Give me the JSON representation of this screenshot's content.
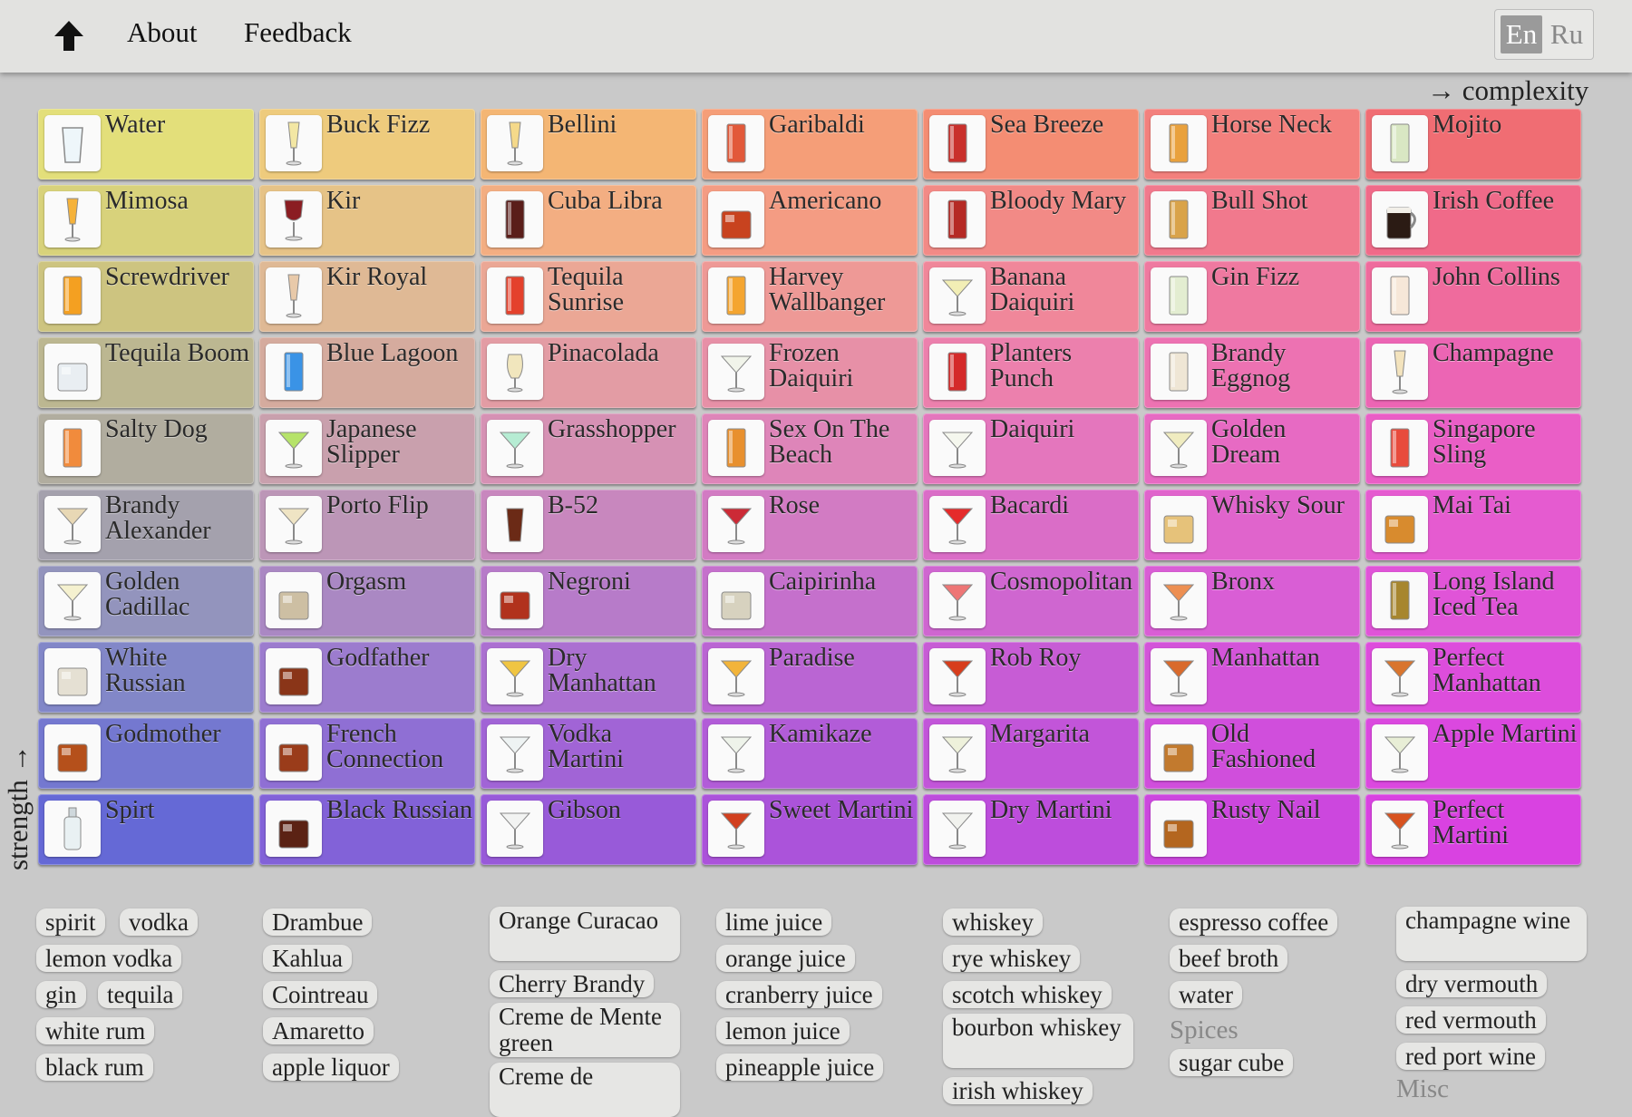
{
  "nav": {
    "about": "About",
    "feedback": "Feedback",
    "lang_en": "En",
    "lang_ru": "Ru"
  },
  "axes": {
    "complexity": "→ complexity",
    "strength": "strength →"
  },
  "cocktails": [
    [
      "Water",
      "Buck Fizz",
      "Bellini",
      "Garibaldi",
      "Sea Breeze",
      "Horse Neck",
      "Mojito"
    ],
    [
      "Mimosa",
      "Kir",
      "Cuba Libra",
      "Americano",
      "Bloody Mary",
      "Bull Shot",
      "Irish Coffee"
    ],
    [
      "Screwdriver",
      "Kir Royal",
      "Tequila Sunrise",
      "Harvey Wallbanger",
      "Banana Daiquiri",
      "Gin Fizz",
      "John Collins"
    ],
    [
      "Tequila Boom",
      "Blue Lagoon",
      "Pinacolada",
      "Frozen Daiquiri",
      "Planters Punch",
      "Brandy Eggnog",
      "Champagne"
    ],
    [
      "Salty Dog",
      "Japanese Slipper",
      "Grasshopper",
      "Sex On The Beach",
      "Daiquiri",
      "Golden Dream",
      "Singapore Sling"
    ],
    [
      "Brandy Alexander",
      "Porto Flip",
      "B-52",
      "Rose",
      "Bacardi",
      "Whisky Sour",
      "Mai Tai"
    ],
    [
      "Golden Cadillac",
      "Orgasm",
      "Negroni",
      "Caipirinha",
      "Cosmopolitan",
      "Bronx",
      "Long Island Iced Tea"
    ],
    [
      "White Russian",
      "Godfather",
      "Dry Manhattan",
      "Paradise",
      "Rob Roy",
      "Manhattan",
      "Perfect Manhattan"
    ],
    [
      "Godmother",
      "French Connection",
      "Vodka Martini",
      "Kamikaze",
      "Margarita",
      "Old Fashioned",
      "Apple Martini"
    ],
    [
      "Spirt",
      "Black Russian",
      "Gibson",
      "Sweet Martini",
      "Dry Martini",
      "Rusty Nail",
      "Perfect Martini"
    ]
  ],
  "cell_colors": [
    [
      "#e3df7a",
      "#eecb7d",
      "#f4b674",
      "#f59e78",
      "#f48d73",
      "#f3807d",
      "#f06d73"
    ],
    [
      "#d8d27b",
      "#e6c387",
      "#f3ae82",
      "#f49c83",
      "#f28a86",
      "#f1798d",
      "#f06a89"
    ],
    [
      "#cdc480",
      "#dfb995",
      "#eba795",
      "#ee9996",
      "#f0879a",
      "#ef79a0",
      "#ef6b9d"
    ],
    [
      "#bcb791",
      "#d5ab9e",
      "#e39ca4",
      "#e790a7",
      "#ec80ad",
      "#ed72b2",
      "#ec65b4"
    ],
    [
      "#b1ad9f",
      "#c9a0ad",
      "#d691b4",
      "#de85b9",
      "#e476bd",
      "#e76ac3",
      "#ea5ec6"
    ],
    [
      "#a4a1ad",
      "#bc96b7",
      "#c887be",
      "#d27bc3",
      "#da6dc7",
      "#e064cc",
      "#e55bd0"
    ],
    [
      "#9394bd",
      "#aa88c3",
      "#b77bc9",
      "#c570cc",
      "#cf66d0",
      "#d95ed5",
      "#e054d8"
    ],
    [
      "#8287c8",
      "#9c7cce",
      "#ab70d1",
      "#ba65d3",
      "#c75cd5",
      "#d354d9",
      "#dd4ddc"
    ],
    [
      "#7478d0",
      "#8f6fd4",
      "#a164d6",
      "#b25cd8",
      "#c255d9",
      "#d04edc",
      "#db48df"
    ],
    [
      "#6569d6",
      "#8262d8",
      "#985ad9",
      "#ab53da",
      "#bd4ddc",
      "#cc47de",
      "#d942e1"
    ]
  ],
  "glass_icons": [
    [
      "tumbler-icon",
      "flute-icon",
      "flute-icon",
      "highball-icon",
      "highball-icon",
      "highball-icon",
      "highball-icon"
    ],
    [
      "flute-icon",
      "wine-glass-icon",
      "highball-icon",
      "rocks-glass-icon",
      "highball-icon",
      "highball-icon",
      "mug-icon"
    ],
    [
      "highball-icon",
      "flute-icon",
      "highball-icon",
      "highball-icon",
      "cocktail-glass-icon",
      "highball-icon",
      "highball-icon"
    ],
    [
      "rocks-glass-icon",
      "highball-icon",
      "hurricane-icon",
      "cocktail-glass-icon",
      "highball-icon",
      "highball-icon",
      "flute-icon"
    ],
    [
      "highball-icon",
      "cocktail-glass-icon",
      "cocktail-glass-icon",
      "highball-icon",
      "cocktail-glass-icon",
      "cocktail-glass-icon",
      "highball-icon"
    ],
    [
      "cocktail-glass-icon",
      "cocktail-glass-icon",
      "shot-glass-icon",
      "cocktail-glass-icon",
      "cocktail-glass-icon",
      "rocks-glass-icon",
      "rocks-glass-icon"
    ],
    [
      "cocktail-glass-icon",
      "rocks-glass-icon",
      "rocks-glass-icon",
      "rocks-glass-icon",
      "cocktail-glass-icon",
      "cocktail-glass-icon",
      "highball-icon"
    ],
    [
      "rocks-glass-icon",
      "rocks-glass-icon",
      "cocktail-glass-icon",
      "cocktail-glass-icon",
      "cocktail-glass-icon",
      "cocktail-glass-icon",
      "cocktail-glass-icon"
    ],
    [
      "rocks-glass-icon",
      "rocks-glass-icon",
      "cocktail-glass-icon",
      "cocktail-glass-icon",
      "cocktail-glass-icon",
      "rocks-glass-icon",
      "cocktail-glass-icon"
    ],
    [
      "bottle-icon",
      "rocks-glass-icon",
      "cocktail-glass-icon",
      "cocktail-glass-icon",
      "cocktail-glass-icon",
      "rocks-glass-icon",
      "cocktail-glass-icon"
    ]
  ],
  "drink_colors": [
    [
      "#eef6fa",
      "#f3e7a4",
      "#f5d98a",
      "#e2593a",
      "#c9302c",
      "#e9a13d",
      "#d9e7c3"
    ],
    [
      "#f5b23a",
      "#8b1d22",
      "#5a1e1a",
      "#c8431f",
      "#b52a25",
      "#d9a34a",
      "#2b1b14"
    ],
    [
      "#f4a021",
      "#e8c9a9",
      "#e4412c",
      "#f4a530",
      "#f2eeb5",
      "#e3edd1",
      "#f6e7d8"
    ],
    [
      "#e9eef2",
      "#3a93e6",
      "#f1e6bd",
      "#f1f4ea",
      "#d42a2a",
      "#efe6d5",
      "#f3e3bd"
    ],
    [
      "#f18b3c",
      "#b6e36a",
      "#b6ecd3",
      "#e8902e",
      "#f5f7ee",
      "#f0ecc0",
      "#e84b3c"
    ],
    [
      "#e8d8b5",
      "#efe4c4",
      "#6b2a16",
      "#cc2a36",
      "#e52a2a",
      "#e6c27a",
      "#d88b2e"
    ],
    [
      "#f5f1cf",
      "#cdbfa3",
      "#b1321d",
      "#d7d2bf",
      "#ee7676",
      "#ed8f52",
      "#a7862e"
    ],
    [
      "#e5e0d3",
      "#8a3518",
      "#f0c542",
      "#f2b43a",
      "#d73d1c",
      "#d96a2c",
      "#d9752e"
    ],
    [
      "#b5501b",
      "#9a3c1a",
      "#eef3f3",
      "#eef3ea",
      "#eef1db",
      "#c27a2e",
      "#e8eed6"
    ],
    [
      "#e9f1f3",
      "#5b2214",
      "#f2f3f2",
      "#d2401f",
      "#f1f2ee",
      "#b4661f",
      "#d8521f"
    ]
  ],
  "ingredient_columns": [
    {
      "items": [
        "spirit",
        "vodka",
        "lemon vodka",
        "gin",
        "tequila",
        "white rum",
        "black rum"
      ]
    },
    {
      "items": [
        "Drambue",
        "Kahlua",
        "Cointreau",
        "Amaretto",
        "apple liquor"
      ]
    },
    {
      "items": [
        "Orange Curacao",
        "Cherry Brandy",
        "Creme de Mente green",
        "Creme de"
      ]
    },
    {
      "items": [
        "lime juice",
        "orange juice",
        "cranberry juice",
        "lemon juice",
        "pineapple juice"
      ]
    },
    {
      "items": [
        "whiskey",
        "rye whiskey",
        "scotch whiskey",
        "bourbon whiskey",
        "irish whiskey"
      ]
    },
    {
      "items": [
        "espresso coffee",
        "beef broth",
        "water",
        "sugar cube"
      ],
      "heading": "Spices"
    },
    {
      "items": [
        "champagne wine",
        "dry vermouth",
        "red vermouth",
        "red port wine"
      ],
      "heading": "Misc"
    }
  ]
}
